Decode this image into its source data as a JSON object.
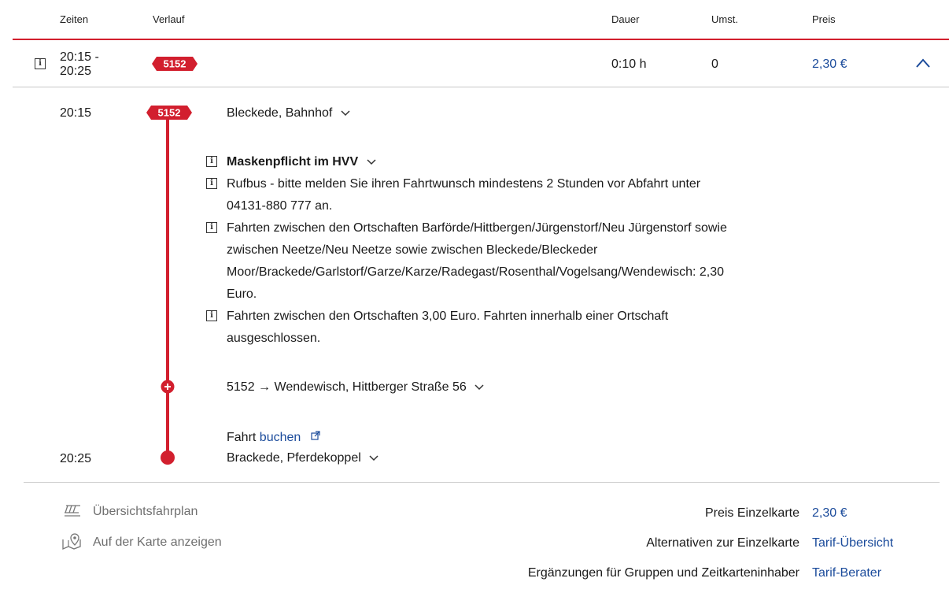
{
  "header": {
    "col_times": "Zeiten",
    "col_route": "Verlauf",
    "col_duration": "Dauer",
    "col_changes": "Umst.",
    "col_price": "Preis"
  },
  "connection": {
    "time_range_start": "20:15 -",
    "time_range_end": "20:25",
    "line_badge": "5152",
    "duration": "0:10 h",
    "changes": "0",
    "price": "2,30 €"
  },
  "detail": {
    "departure_time": "20:15",
    "departure_stop": "Bleckede, Bahnhof",
    "line_badge": "5152",
    "notices": [
      "Maskenpflicht im HVV",
      "Rufbus - bitte melden Sie ihren Fahrtwunsch mindestens 2 Stunden vor Abfahrt unter 04131-880 777 an.",
      "Fahrten zwischen den Ortschaften Barförde/Hittbergen/Jürgenstorf/Neu Jürgenstorf sowie zwischen Neetze/Neu Neetze sowie zwischen Bleckede/Bleckeder Moor/Brackede/Garlstorf/Garze/Karze/Radegast/Rosenthal/Vogelsang/Wendewisch: 2,30 Euro.",
      "Fahrten zwischen den Ortschaften 3,00 Euro. Fahrten innerhalb einer Ortschaft ausgeschlossen."
    ],
    "direction_line": "5152",
    "direction_arrow": "→",
    "direction_dest": "Wendewisch, Hittberger Straße 56",
    "book_prefix": "Fahrt",
    "book_link": "buchen",
    "arrival_time": "20:25",
    "arrival_stop": "Brackede, Pferdekoppel"
  },
  "footer": {
    "timetable_link": "Übersichtsfahrplan",
    "map_link": "Auf der Karte anzeigen",
    "price_label": "Preis Einzelkarte",
    "price_value": "2,30 €",
    "alt_label": "Alternativen zur Einzelkarte",
    "alt_link": "Tarif-Übersicht",
    "extra_label": "Ergänzungen für Gruppen und Zeitkarteninhaber",
    "extra_link": "Tarif-Berater"
  },
  "colors": {
    "accent_red": "#d21f2e",
    "link_blue": "#1b4b9b"
  },
  "icons": [
    "info-icon",
    "chevron-up-icon",
    "chevron-down-icon",
    "external-link-icon",
    "timetable-icon",
    "map-pin-icon"
  ]
}
